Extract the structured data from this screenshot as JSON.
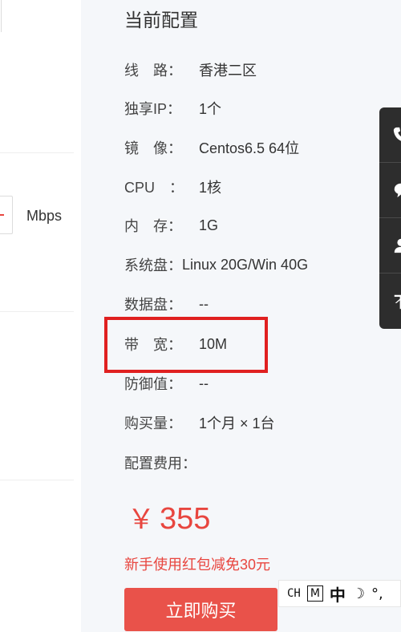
{
  "form": {
    "bandwidth_unit": "Mbps"
  },
  "config": {
    "title": "当前配置",
    "rows": [
      {
        "label": "线　路：",
        "value": "香港二区"
      },
      {
        "label": "独享IP：",
        "value": "1个"
      },
      {
        "label": "镜　像：",
        "value": "Centos6.5 64位"
      },
      {
        "label": "CPU　：",
        "value": "1核"
      },
      {
        "label": "内　存：",
        "value": "1G"
      },
      {
        "label": "系统盘：",
        "value": "Linux 20G/Win 40G"
      },
      {
        "label": "数据盘：",
        "value": "--"
      },
      {
        "label": "带　宽：",
        "value": "10M"
      },
      {
        "label": "防御值：",
        "value": "--"
      },
      {
        "label": "购买量：",
        "value": "1个月 × 1台"
      },
      {
        "label": "配置费用：",
        "value": ""
      }
    ],
    "price_currency": "￥",
    "price_amount": "355",
    "promo_text": "新手使用红包减免30元",
    "buy_button_label": "立即购买"
  },
  "float_bar": {
    "icons": [
      "phone-icon",
      "message-icon",
      "user-icon",
      "back-to-top-icon"
    ]
  },
  "ime": {
    "mode": "CH",
    "m_label": "M",
    "zh_label": "中"
  },
  "colors": {
    "accent": "#e8463f",
    "highlight": "#e02020",
    "panel_bg": "#f5f7fa",
    "float_bar_bg": "#2d2d2d"
  }
}
